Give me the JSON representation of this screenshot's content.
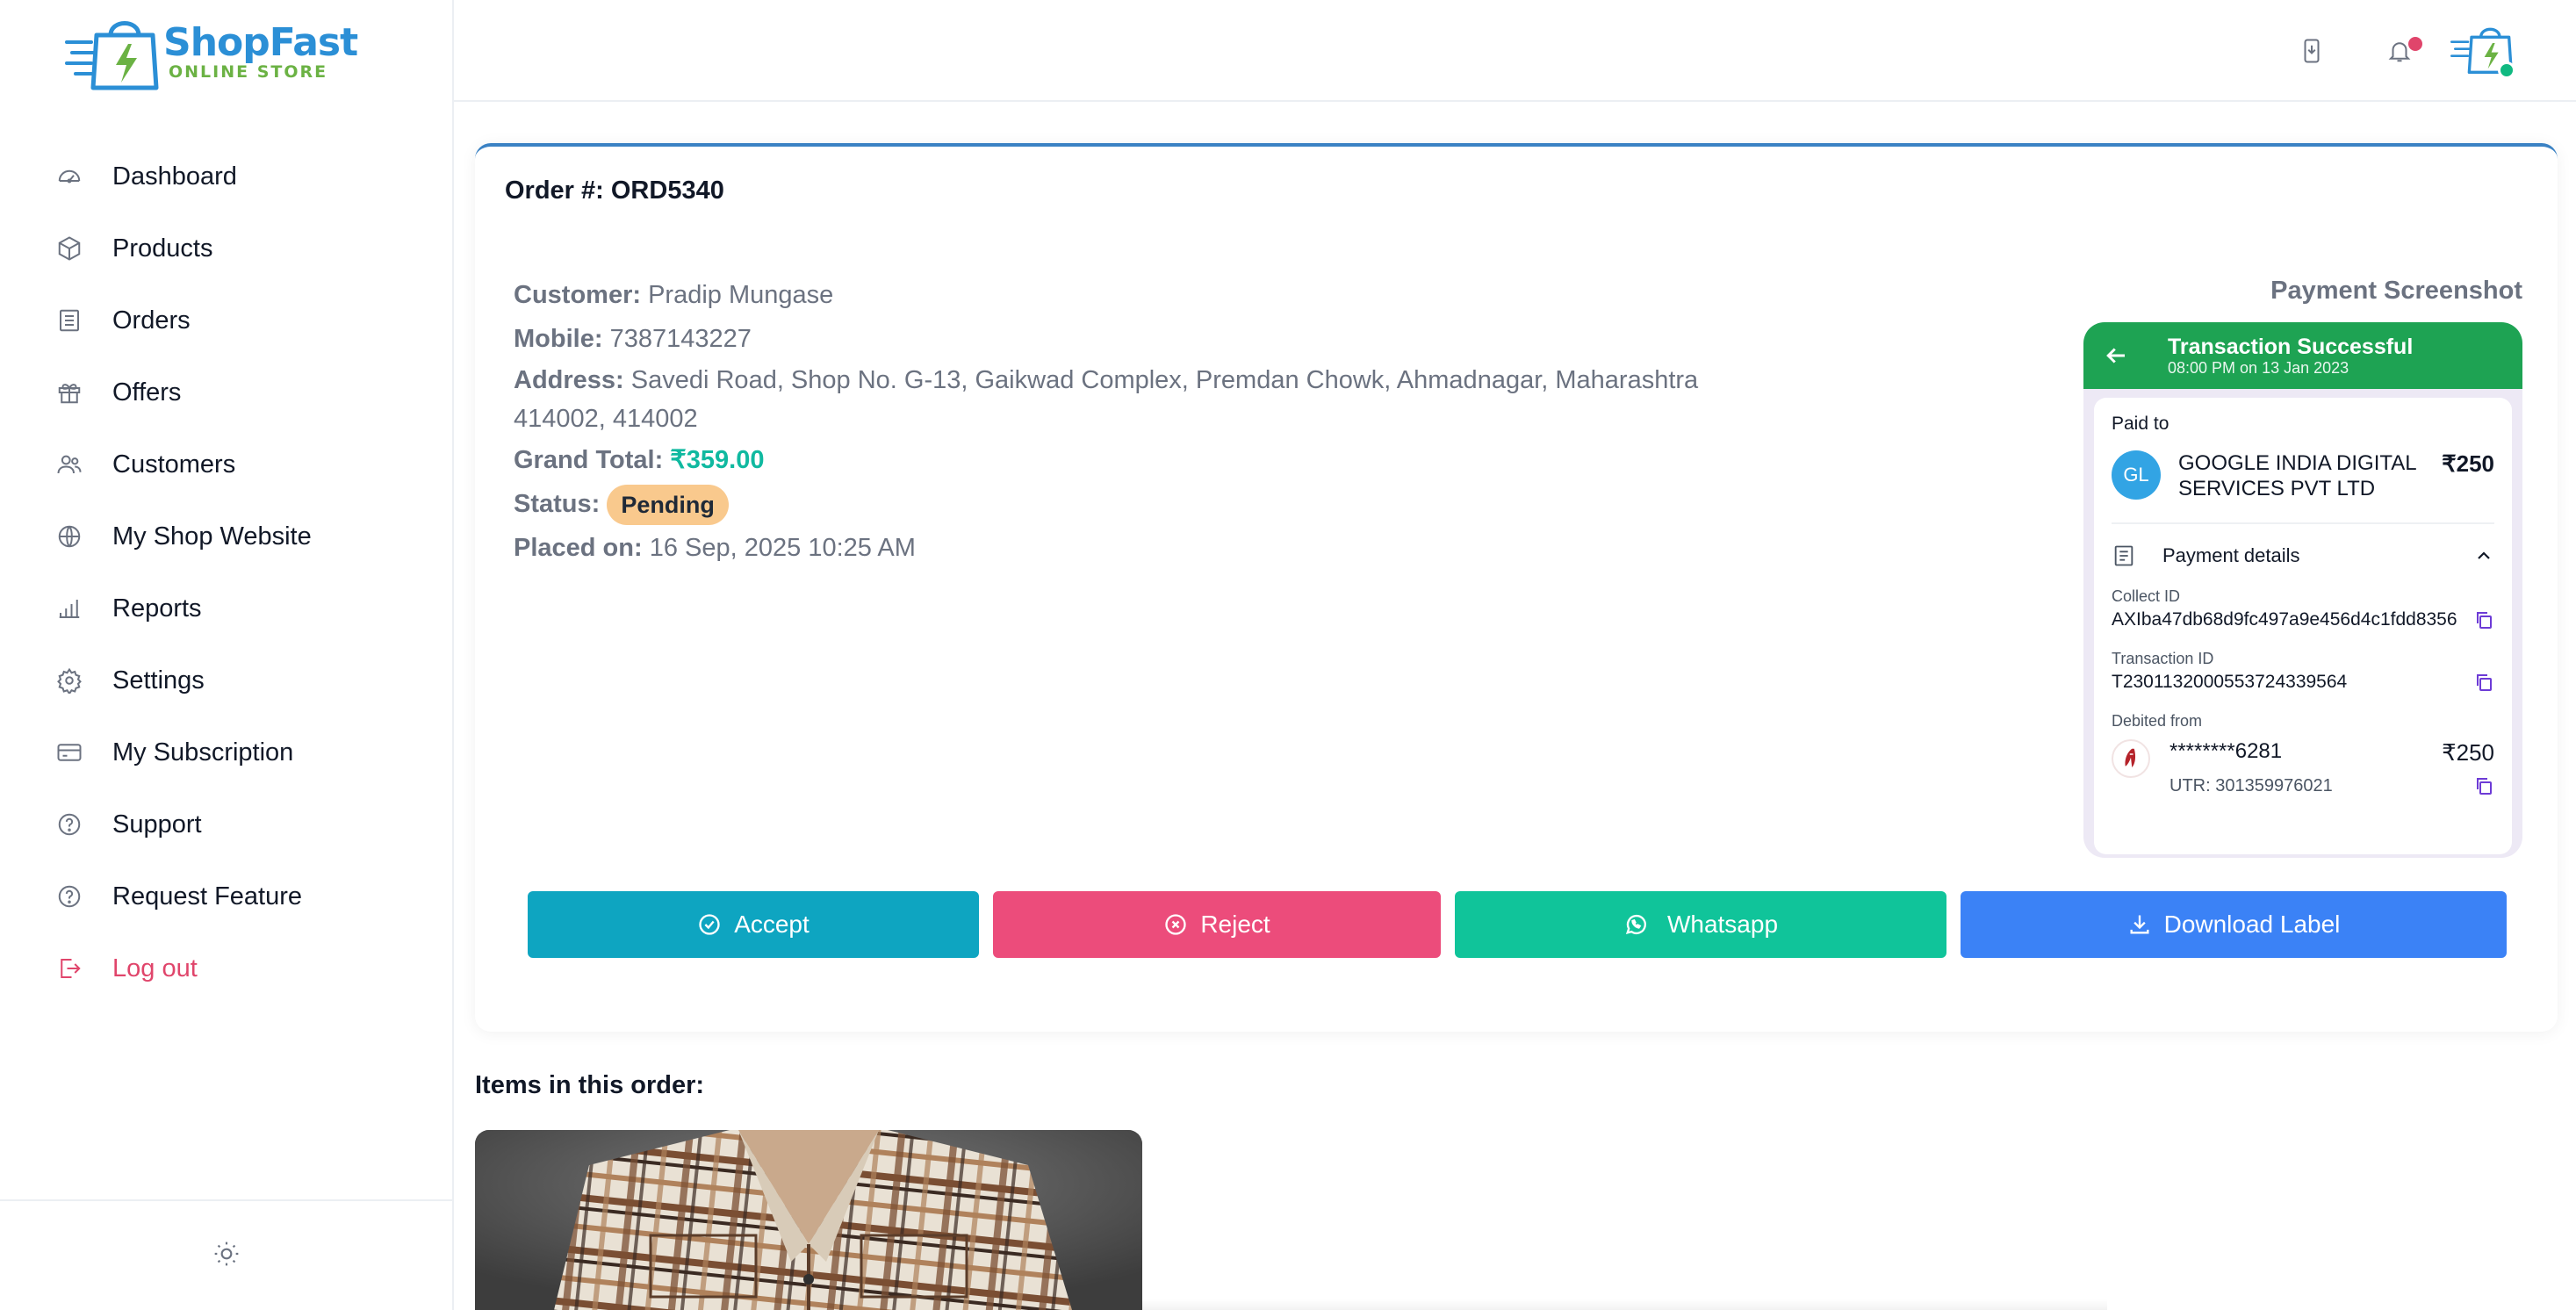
{
  "brand": {
    "name_part1": "Shop",
    "name_part2": "Fast",
    "tagline": "ONLINE STORE"
  },
  "sidebar": {
    "items": [
      {
        "label": "Dashboard",
        "icon": "dashboard-icon"
      },
      {
        "label": "Products",
        "icon": "box-icon"
      },
      {
        "label": "Orders",
        "icon": "orders-icon"
      },
      {
        "label": "Offers",
        "icon": "gift-icon"
      },
      {
        "label": "Customers",
        "icon": "users-icon"
      },
      {
        "label": "My Shop Website",
        "icon": "globe-icon"
      },
      {
        "label": "Reports",
        "icon": "bar-chart-icon"
      },
      {
        "label": "Settings",
        "icon": "gear-icon"
      },
      {
        "label": "My Subscription",
        "icon": "credit-card-icon"
      },
      {
        "label": "Support",
        "icon": "help-icon"
      },
      {
        "label": "Request Feature",
        "icon": "help-icon"
      },
      {
        "label": "Log out",
        "icon": "logout-icon"
      }
    ],
    "footer_icon": "sun-icon"
  },
  "colors": {
    "accent_blue": "#3b82f6",
    "accept": "#0ea5c1",
    "reject": "#ec4c7b",
    "whatsapp": "#10c49a",
    "grand_total": "#10b9a0",
    "status_pending": "#f9c98d",
    "logout": "#e0456b"
  },
  "order": {
    "title": "Order #: ORD5340",
    "customer_label": "Customer:",
    "customer": "Pradip Mungase",
    "mobile_label": "Mobile:",
    "mobile": "7387143227",
    "address_label": "Address:",
    "address": "Savedi Road, Shop No. G-13, Gaikwad Complex, Premdan Chowk, Ahmadnagar, Maharashtra 414002, 414002",
    "grand_total_label": "Grand Total:",
    "grand_total": "₹359.00",
    "status_label": "Status:",
    "status": "Pending",
    "placed_label": "Placed on:",
    "placed_on": "16 Sep, 2025 10:25 AM",
    "payment_screenshot_title": "Payment Screenshot"
  },
  "payment": {
    "header_title": "Transaction Successful",
    "header_sub": "08:00 PM on 13 Jan 2023",
    "paid_to": "Paid to",
    "payee_initials": "GL",
    "payee_name": "GOOGLE INDIA DIGITAL SERVICES PVT LTD",
    "amount": "₹250",
    "details_label": "Payment details",
    "collect_id_label": "Collect ID",
    "collect_id": "AXIba47db68d9fc497a9e456d4c1fdd8356",
    "transaction_id_label": "Transaction ID",
    "transaction_id": "T2301132000553724339564",
    "debited_from_label": "Debited from",
    "account": "********6281",
    "debit_amount": "₹250",
    "utr": "UTR: 301359976021"
  },
  "actions": {
    "accept": "Accept",
    "reject": "Reject",
    "whatsapp": "Whatsapp",
    "download_label": "Download Label"
  },
  "items": {
    "title": "Items in this order:"
  }
}
